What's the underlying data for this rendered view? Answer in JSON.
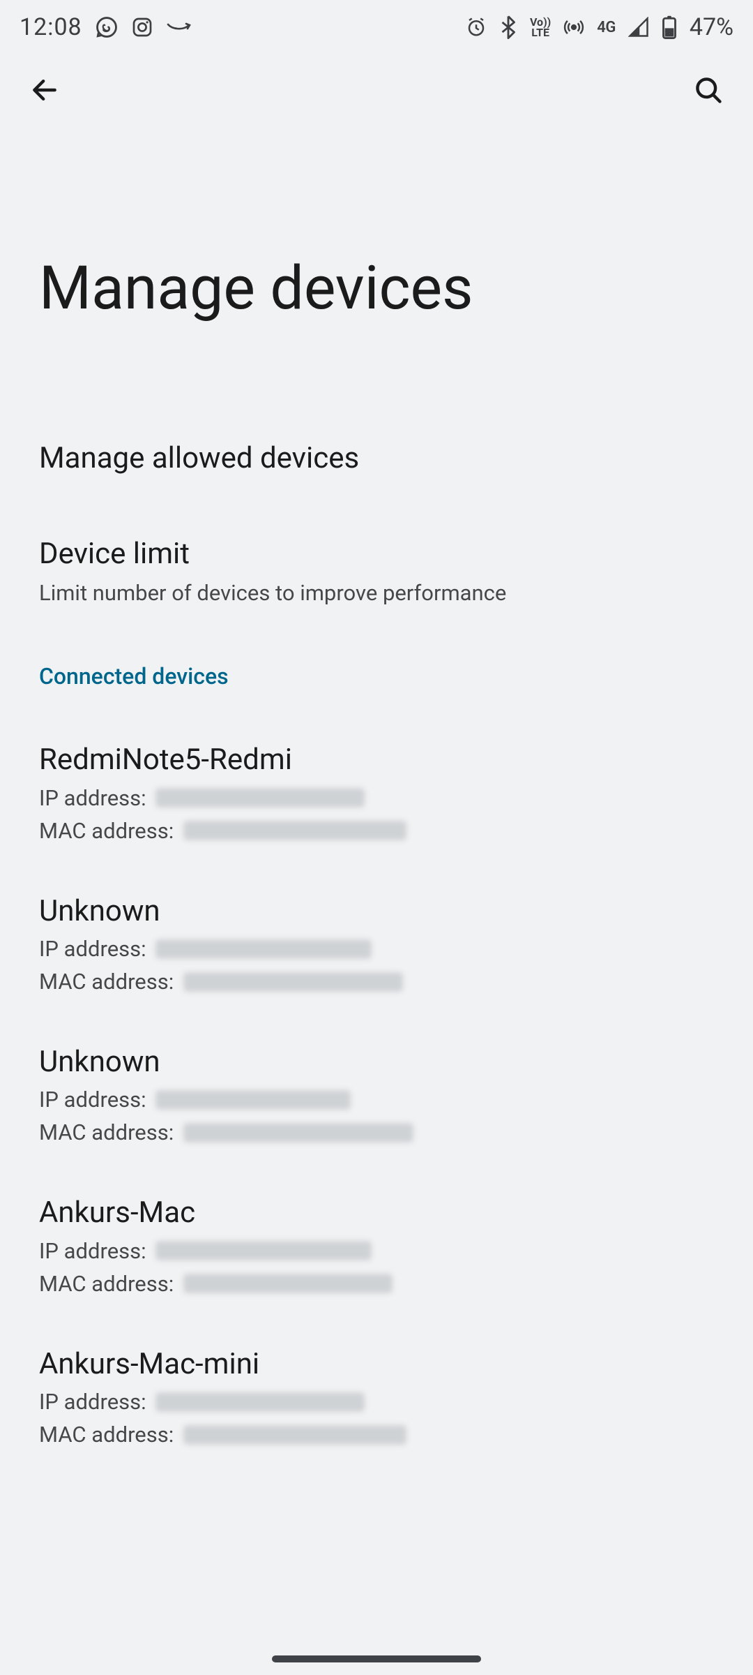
{
  "statusbar": {
    "time": "12:08",
    "battery_pct": "47%",
    "network_label": "4G"
  },
  "page": {
    "title": "Manage devices"
  },
  "rows": {
    "manage_allowed": {
      "title": "Manage allowed devices",
      "sub": ""
    },
    "device_limit": {
      "title": "Device limit",
      "sub": "Limit number of devices to improve performance"
    }
  },
  "section": {
    "connected": "Connected devices"
  },
  "labels": {
    "ip": "IP address: ",
    "mac": "MAC address: "
  },
  "devices": [
    {
      "name": "RedmiNote5-Redmi",
      "ip_blur_w": 300,
      "mac_blur_w": 320
    },
    {
      "name": "Unknown",
      "ip_blur_w": 310,
      "mac_blur_w": 315
    },
    {
      "name": "Unknown",
      "ip_blur_w": 280,
      "mac_blur_w": 330
    },
    {
      "name": "Ankurs-Mac",
      "ip_blur_w": 310,
      "mac_blur_w": 300
    },
    {
      "name": "Ankurs-Mac-mini",
      "ip_blur_w": 300,
      "mac_blur_w": 320
    }
  ]
}
